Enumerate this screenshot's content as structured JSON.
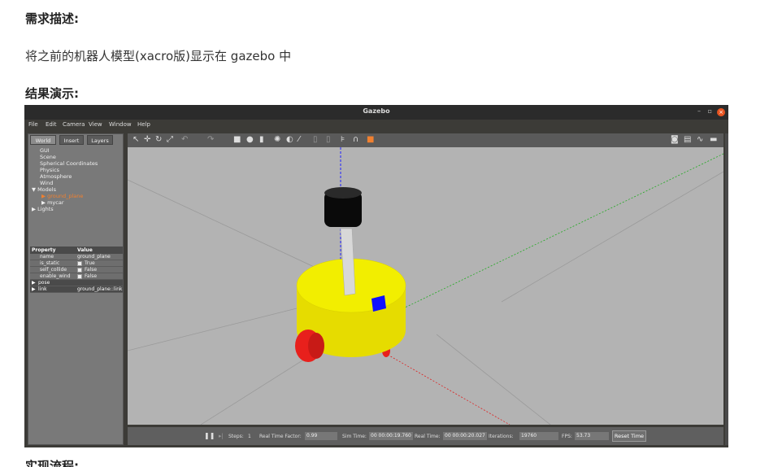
{
  "article": {
    "heading1": "需求描述:",
    "paragraph": "将之前的机器人模型(xacro版)显示在 gazebo 中",
    "heading2": "结果演示:",
    "heading3": "实现流程:"
  },
  "window": {
    "title": "Gazebo",
    "minimize": "–",
    "maximize": "▫",
    "close": "×"
  },
  "menu": [
    "File",
    "Edit",
    "Camera",
    "View",
    "Window",
    "Help"
  ],
  "left_panel": {
    "tabs": [
      "World",
      "Insert",
      "Layers"
    ],
    "tree": [
      {
        "label": "GUI",
        "indent": 1
      },
      {
        "label": "Scene",
        "indent": 1
      },
      {
        "label": "Spherical Coordinates",
        "indent": 1
      },
      {
        "label": "Physics",
        "indent": 1
      },
      {
        "label": "Atmosphere",
        "indent": 1
      },
      {
        "label": "Wind",
        "indent": 1
      },
      {
        "label": "Models",
        "indent": 0
      },
      {
        "label": "ground_plane",
        "indent": 2
      },
      {
        "label": "mycar",
        "indent": 2
      },
      {
        "label": "Lights",
        "indent": 0
      }
    ],
    "tree_arrows": {
      "models": "▼",
      "ground_plane": "▶",
      "mycar": "▶",
      "lights": "▶"
    },
    "props_header": {
      "property": "Property",
      "value": "Value"
    },
    "props": {
      "name_key": "name",
      "name_val": "ground_plane",
      "static_key": "is_static",
      "static_val": "True",
      "collide_key": "self_collide",
      "collide_val": "False",
      "wind_key": "enable_wind",
      "wind_val": "False",
      "pose_key": "pose",
      "link_key": "link",
      "link_val": "ground_plane::link"
    }
  },
  "bottom_bar": {
    "pause": "❚❚",
    "step": "▸|",
    "steps_label": "Steps:",
    "steps_val": "1",
    "rtf_label": "Real Time Factor:",
    "rtf_val": "0.99",
    "sim_label": "Sim Time:",
    "sim_val": "00 00:00:19.760",
    "real_label": "Real Time:",
    "real_val": "00 00:00:20.027",
    "iter_label": "Iterations:",
    "iter_val": "19760",
    "fps_label": "FPS:",
    "fps_val": "53.73",
    "reset": "Reset Time"
  },
  "colors": {
    "robot_body": "#f2ee00",
    "wheel": "#e8201c",
    "camera": "#1010ff",
    "lidar": "#0a0a0a",
    "ground": "#b3b3b3",
    "highlight": "#f08030"
  }
}
